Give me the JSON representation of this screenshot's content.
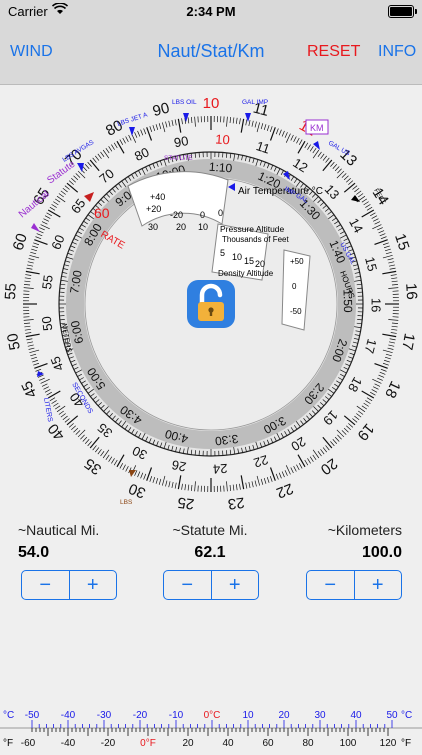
{
  "status": {
    "carrier": "Carrier",
    "time": "2:34 PM"
  },
  "nav": {
    "left": "WIND",
    "title": "Naut/Stat/Km",
    "reset": "RESET",
    "info": "INFO"
  },
  "colors": {
    "accent": "#1a73e8",
    "red": "#e8191e",
    "blue_label": "#1a1ae8",
    "purple": "#9a2fd1"
  },
  "dial": {
    "outer_scale_labels": [
      "10",
      "11",
      "12",
      "13",
      "14",
      "15",
      "16",
      "17",
      "18",
      "19",
      "20",
      "22",
      "23",
      "25",
      "30",
      "35",
      "40",
      "45",
      "50",
      "55",
      "60",
      "65",
      "70",
      "80",
      "90"
    ],
    "inner_scale_labels": [
      "10",
      "11",
      "12",
      "13",
      "14",
      "15",
      "16",
      "17",
      "18",
      "19",
      "20",
      "22",
      "24",
      "26",
      "30",
      "35",
      "40",
      "45",
      "50",
      "55",
      "60",
      "65",
      "70",
      "80",
      "90"
    ],
    "time_labels": [
      "1:10",
      "1:20",
      "1:30",
      "1:40",
      "1:50",
      "2:00",
      "2:30",
      "3:00",
      "3:30",
      "4:00",
      "4:30",
      "5:00",
      "6:00",
      "7:00",
      "8:00",
      "9:00",
      "10:00"
    ],
    "pointer_labels": {
      "lbs_avgas": "LBS AVGAS",
      "lbs_jet_a": "LBS JET A",
      "lbs_oil": "LBS OIL",
      "gal_imp": "GAL IMP",
      "km": "KM",
      "gal_us": "GAL US",
      "imp_gal": "IMP GAL",
      "us_gal": "US GAL",
      "feet": "FEET",
      "statute": "STATUTE",
      "nautical": "Nautical",
      "statute_mark": "Statute",
      "liters": "LITERS",
      "meters": "METERS",
      "seconds": "SECONDS",
      "hours": "HOURS",
      "lbs": "LBS",
      "rate": "RATE",
      "rate_value": "60"
    },
    "window": {
      "air_temp": "Air Temperature °C",
      "pressure_alt": "Pressure Altitude",
      "thousands": "Thousands of Feet",
      "density_alt": "Density Altitude"
    },
    "window_ticks": [
      "+40",
      "+20",
      "0",
      "-20",
      "30",
      "20",
      "10",
      "0",
      "5",
      "10",
      "15",
      "20",
      "+50",
      "0",
      "-50"
    ]
  },
  "calcs": [
    {
      "label": "~Nautical Mi.",
      "value": "54.0"
    },
    {
      "label": "~Statute Mi.",
      "value": "62.1"
    },
    {
      "label": "~Kilometers",
      "value": "100.0"
    }
  ],
  "steppers": {
    "minus": "−",
    "plus": "+"
  },
  "temperature": {
    "c_unit": "°C",
    "f_unit": "°F",
    "c_labels": [
      "-50",
      "-40",
      "-30",
      "-20",
      "-10",
      "0°C",
      "10",
      "20",
      "30",
      "40",
      "50"
    ],
    "f_labels": [
      "-60",
      "-40",
      "-20",
      "0°F",
      "20",
      "40",
      "60",
      "80",
      "100",
      "120"
    ]
  }
}
